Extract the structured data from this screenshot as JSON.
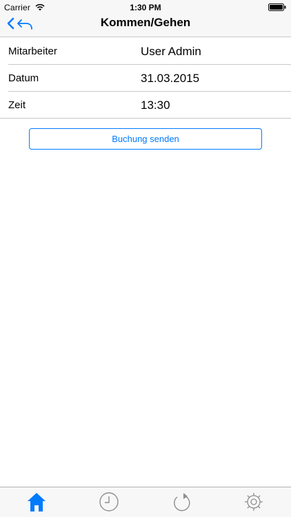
{
  "status_bar": {
    "carrier": "Carrier",
    "time": "1:30 PM",
    "wifi_icon": "wifi-icon",
    "battery_icon": "battery-icon"
  },
  "nav": {
    "title": "Kommen/Gehen",
    "back_icon": "back-icon",
    "accent_color": "#007aff"
  },
  "form": {
    "rows": [
      {
        "label": "Mitarbeiter",
        "value": "User Admin"
      },
      {
        "label": "Datum",
        "value": "31.03.2015"
      },
      {
        "label": "Zeit",
        "value": "13:30"
      }
    ]
  },
  "actions": {
    "send_label": "Buchung senden"
  },
  "tabbar": {
    "tabs": [
      {
        "icon": "home-icon",
        "active": true
      },
      {
        "icon": "clock-icon",
        "active": false
      },
      {
        "icon": "refresh-icon",
        "active": false
      },
      {
        "icon": "gear-icon",
        "active": false
      }
    ],
    "active_color": "#007aff",
    "inactive_color": "#8e8e93"
  }
}
